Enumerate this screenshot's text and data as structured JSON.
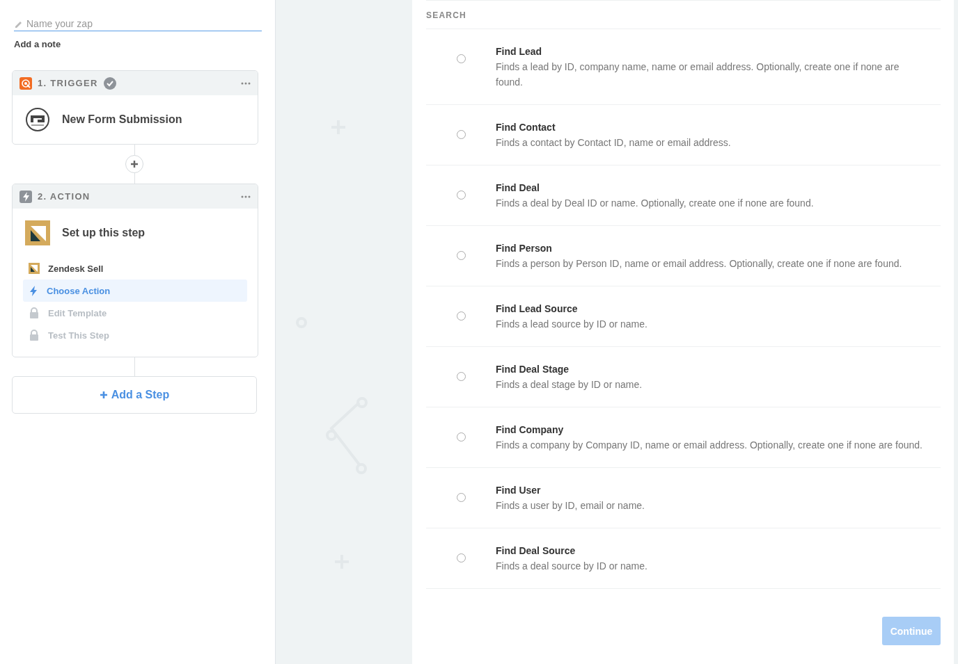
{
  "zap_name": {
    "placeholder": "Name your zap"
  },
  "note_link": "Add a note",
  "steps": [
    {
      "kind": "trigger",
      "label": "1. TRIGGER",
      "complete": true,
      "title": "New Form Submission"
    },
    {
      "kind": "action",
      "label": "2. ACTION",
      "complete": false,
      "title": "Set up this step",
      "items": [
        {
          "kind": "app",
          "label": "Zendesk Sell",
          "selected": false,
          "disabled": false
        },
        {
          "kind": "action",
          "label": "Choose Action",
          "selected": true,
          "disabled": false
        },
        {
          "kind": "lock",
          "label": "Edit Template",
          "selected": false,
          "disabled": true
        },
        {
          "kind": "lock",
          "label": "Test This Step",
          "selected": false,
          "disabled": true
        }
      ]
    }
  ],
  "add_step": "Add a Step",
  "section_heading": "SEARCH",
  "options": [
    {
      "title": "Find Lead",
      "description": "Finds a lead by ID, company name, name or email address. Optionally, create one if none are found.",
      "selected": false
    },
    {
      "title": "Find Contact",
      "description": "Finds a contact by Contact ID, name or email address.",
      "selected": false
    },
    {
      "title": "Find Deal",
      "description": "Finds a deal by Deal ID or name. Optionally, create one if none are found.",
      "selected": false
    },
    {
      "title": "Find Person",
      "description": "Finds a person by Person ID, name or email address. Optionally, create one if none are found.",
      "selected": false
    },
    {
      "title": "Find Lead Source",
      "description": "Finds a lead source by ID or name.",
      "selected": false
    },
    {
      "title": "Find Deal Stage",
      "description": "Finds a deal stage by ID or name.",
      "selected": false
    },
    {
      "title": "Find Company",
      "description": "Finds a company by Company ID, name or email address. Optionally, create one if none are found.",
      "selected": false
    },
    {
      "title": "Find User",
      "description": "Finds a user by ID, email or name.",
      "selected": false
    },
    {
      "title": "Find Deal Source",
      "description": "Finds a deal source by ID or name.",
      "selected": false
    }
  ],
  "continue_button": {
    "label": "Continue",
    "disabled": true
  }
}
